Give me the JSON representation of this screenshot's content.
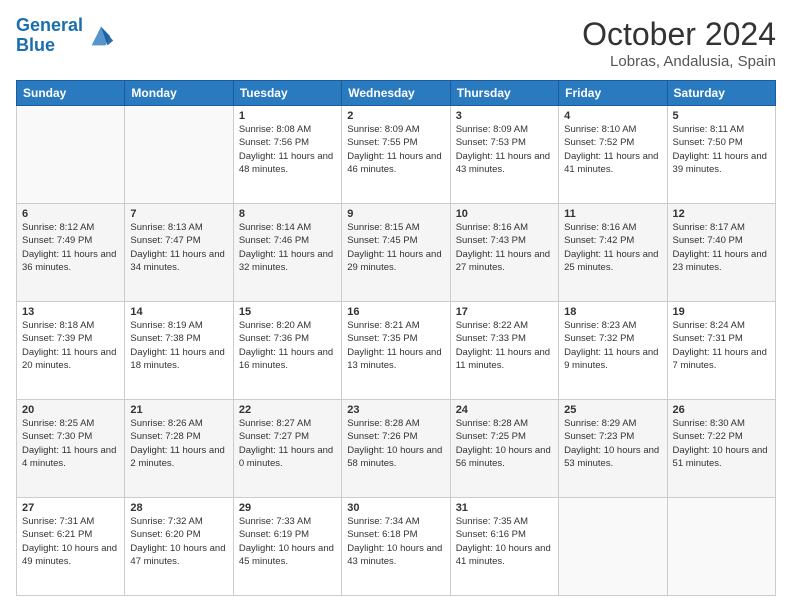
{
  "header": {
    "logo_line1": "General",
    "logo_line2": "Blue",
    "month": "October 2024",
    "location": "Lobras, Andalusia, Spain"
  },
  "weekdays": [
    "Sunday",
    "Monday",
    "Tuesday",
    "Wednesday",
    "Thursday",
    "Friday",
    "Saturday"
  ],
  "weeks": [
    [
      {
        "day": "",
        "info": ""
      },
      {
        "day": "",
        "info": ""
      },
      {
        "day": "1",
        "info": "Sunrise: 8:08 AM\nSunset: 7:56 PM\nDaylight: 11 hours and 48 minutes."
      },
      {
        "day": "2",
        "info": "Sunrise: 8:09 AM\nSunset: 7:55 PM\nDaylight: 11 hours and 46 minutes."
      },
      {
        "day": "3",
        "info": "Sunrise: 8:09 AM\nSunset: 7:53 PM\nDaylight: 11 hours and 43 minutes."
      },
      {
        "day": "4",
        "info": "Sunrise: 8:10 AM\nSunset: 7:52 PM\nDaylight: 11 hours and 41 minutes."
      },
      {
        "day": "5",
        "info": "Sunrise: 8:11 AM\nSunset: 7:50 PM\nDaylight: 11 hours and 39 minutes."
      }
    ],
    [
      {
        "day": "6",
        "info": "Sunrise: 8:12 AM\nSunset: 7:49 PM\nDaylight: 11 hours and 36 minutes."
      },
      {
        "day": "7",
        "info": "Sunrise: 8:13 AM\nSunset: 7:47 PM\nDaylight: 11 hours and 34 minutes."
      },
      {
        "day": "8",
        "info": "Sunrise: 8:14 AM\nSunset: 7:46 PM\nDaylight: 11 hours and 32 minutes."
      },
      {
        "day": "9",
        "info": "Sunrise: 8:15 AM\nSunset: 7:45 PM\nDaylight: 11 hours and 29 minutes."
      },
      {
        "day": "10",
        "info": "Sunrise: 8:16 AM\nSunset: 7:43 PM\nDaylight: 11 hours and 27 minutes."
      },
      {
        "day": "11",
        "info": "Sunrise: 8:16 AM\nSunset: 7:42 PM\nDaylight: 11 hours and 25 minutes."
      },
      {
        "day": "12",
        "info": "Sunrise: 8:17 AM\nSunset: 7:40 PM\nDaylight: 11 hours and 23 minutes."
      }
    ],
    [
      {
        "day": "13",
        "info": "Sunrise: 8:18 AM\nSunset: 7:39 PM\nDaylight: 11 hours and 20 minutes."
      },
      {
        "day": "14",
        "info": "Sunrise: 8:19 AM\nSunset: 7:38 PM\nDaylight: 11 hours and 18 minutes."
      },
      {
        "day": "15",
        "info": "Sunrise: 8:20 AM\nSunset: 7:36 PM\nDaylight: 11 hours and 16 minutes."
      },
      {
        "day": "16",
        "info": "Sunrise: 8:21 AM\nSunset: 7:35 PM\nDaylight: 11 hours and 13 minutes."
      },
      {
        "day": "17",
        "info": "Sunrise: 8:22 AM\nSunset: 7:33 PM\nDaylight: 11 hours and 11 minutes."
      },
      {
        "day": "18",
        "info": "Sunrise: 8:23 AM\nSunset: 7:32 PM\nDaylight: 11 hours and 9 minutes."
      },
      {
        "day": "19",
        "info": "Sunrise: 8:24 AM\nSunset: 7:31 PM\nDaylight: 11 hours and 7 minutes."
      }
    ],
    [
      {
        "day": "20",
        "info": "Sunrise: 8:25 AM\nSunset: 7:30 PM\nDaylight: 11 hours and 4 minutes."
      },
      {
        "day": "21",
        "info": "Sunrise: 8:26 AM\nSunset: 7:28 PM\nDaylight: 11 hours and 2 minutes."
      },
      {
        "day": "22",
        "info": "Sunrise: 8:27 AM\nSunset: 7:27 PM\nDaylight: 11 hours and 0 minutes."
      },
      {
        "day": "23",
        "info": "Sunrise: 8:28 AM\nSunset: 7:26 PM\nDaylight: 10 hours and 58 minutes."
      },
      {
        "day": "24",
        "info": "Sunrise: 8:28 AM\nSunset: 7:25 PM\nDaylight: 10 hours and 56 minutes."
      },
      {
        "day": "25",
        "info": "Sunrise: 8:29 AM\nSunset: 7:23 PM\nDaylight: 10 hours and 53 minutes."
      },
      {
        "day": "26",
        "info": "Sunrise: 8:30 AM\nSunset: 7:22 PM\nDaylight: 10 hours and 51 minutes."
      }
    ],
    [
      {
        "day": "27",
        "info": "Sunrise: 7:31 AM\nSunset: 6:21 PM\nDaylight: 10 hours and 49 minutes."
      },
      {
        "day": "28",
        "info": "Sunrise: 7:32 AM\nSunset: 6:20 PM\nDaylight: 10 hours and 47 minutes."
      },
      {
        "day": "29",
        "info": "Sunrise: 7:33 AM\nSunset: 6:19 PM\nDaylight: 10 hours and 45 minutes."
      },
      {
        "day": "30",
        "info": "Sunrise: 7:34 AM\nSunset: 6:18 PM\nDaylight: 10 hours and 43 minutes."
      },
      {
        "day": "31",
        "info": "Sunrise: 7:35 AM\nSunset: 6:16 PM\nDaylight: 10 hours and 41 minutes."
      },
      {
        "day": "",
        "info": ""
      },
      {
        "day": "",
        "info": ""
      }
    ]
  ]
}
